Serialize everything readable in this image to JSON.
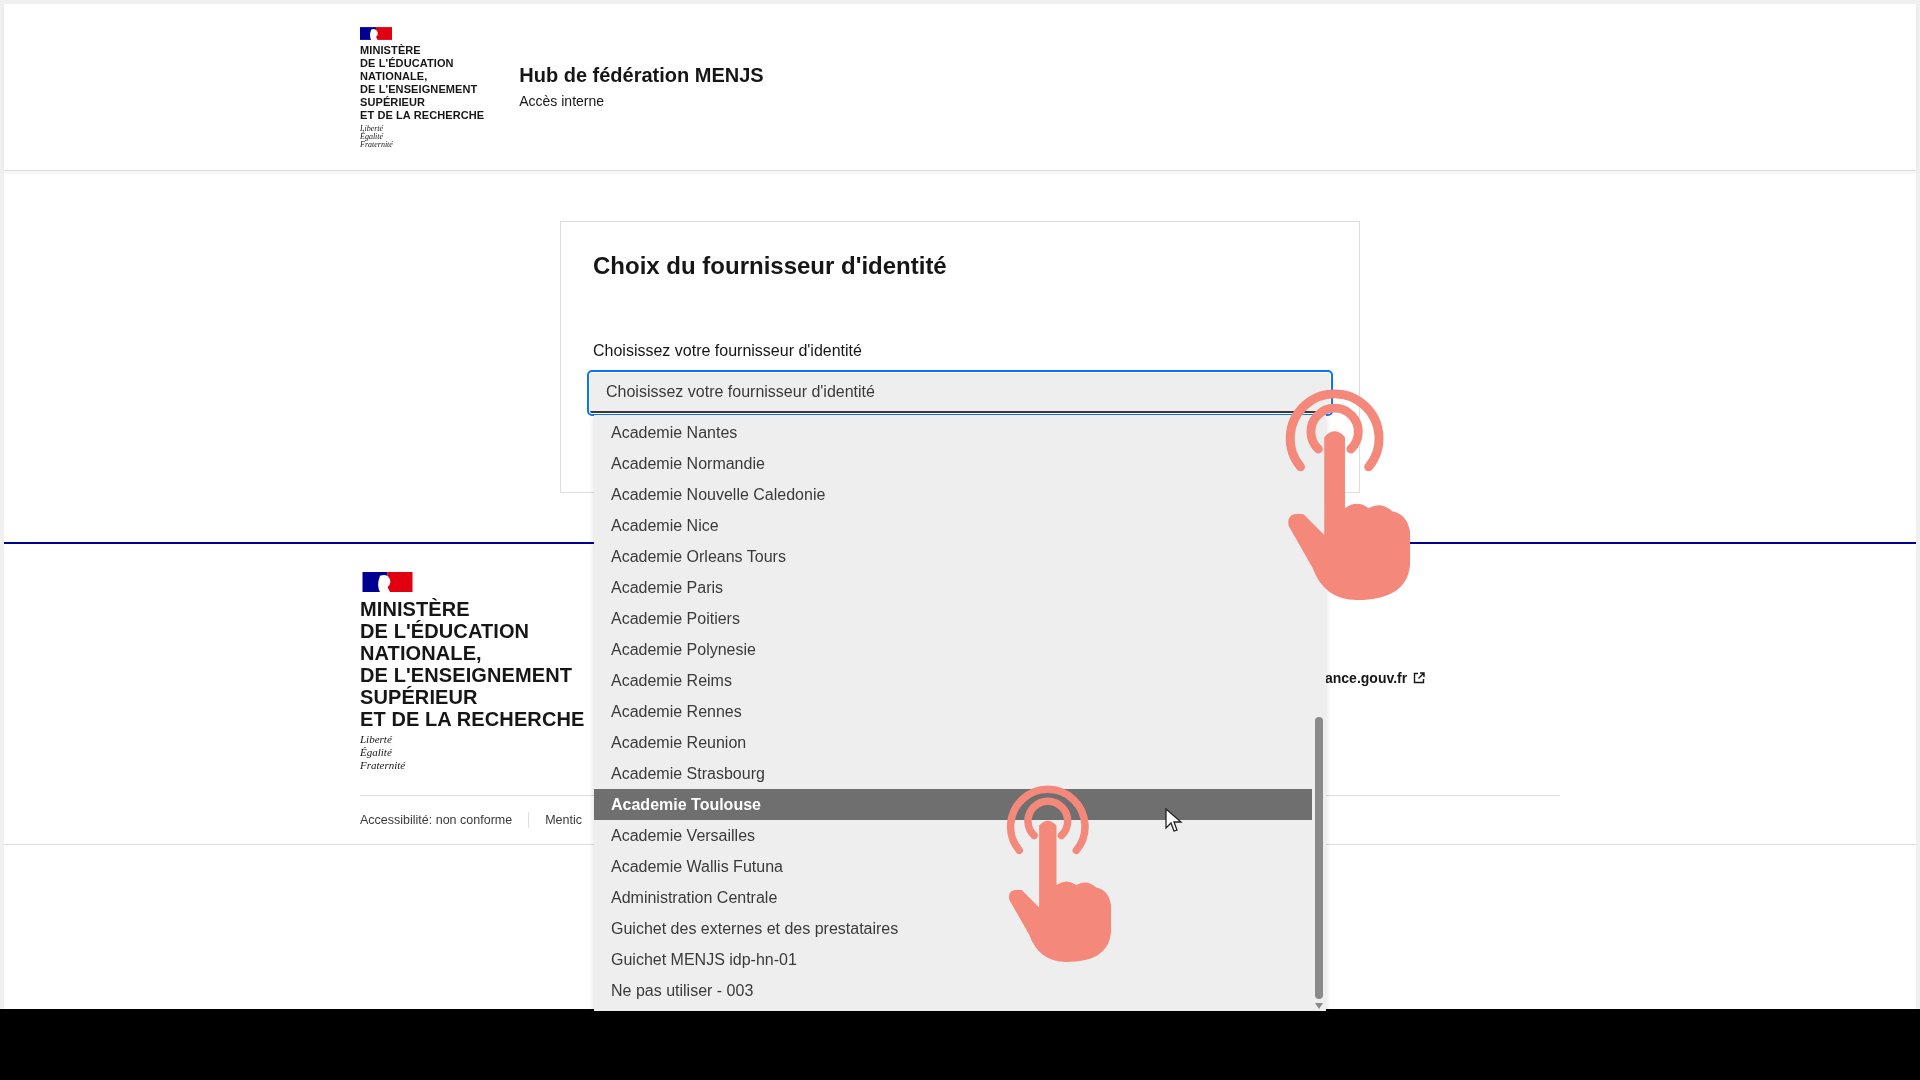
{
  "header": {
    "logo": {
      "lines": [
        "MINISTÈRE",
        "DE L'ÉDUCATION",
        "NATIONALE,",
        "DE L'ENSEIGNEMENT",
        "SUPÉRIEUR",
        "ET DE LA RECHERCHE"
      ],
      "motto": [
        "Liberté",
        "Égalité",
        "Fraternité"
      ]
    },
    "title": "Hub de fédération MENJS",
    "subtitle": "Accès interne"
  },
  "card": {
    "title": "Choix du fournisseur d'identité",
    "label": "Choisissez votre fournisseur d'identité",
    "select": {
      "value": "Choisissez votre fournisseur d'identité",
      "expanded": true
    }
  },
  "dropdown_options": [
    {
      "label": "Academie Nantes",
      "selected": false
    },
    {
      "label": "Academie Normandie",
      "selected": false
    },
    {
      "label": "Academie Nouvelle Caledonie",
      "selected": false
    },
    {
      "label": "Academie Nice",
      "selected": false
    },
    {
      "label": "Academie Orleans Tours",
      "selected": false
    },
    {
      "label": "Academie Paris",
      "selected": false
    },
    {
      "label": "Academie Poitiers",
      "selected": false
    },
    {
      "label": "Academie Polynesie",
      "selected": false
    },
    {
      "label": "Academie Reims",
      "selected": false
    },
    {
      "label": "Academie Rennes",
      "selected": false
    },
    {
      "label": "Academie Reunion",
      "selected": false
    },
    {
      "label": "Academie Strasbourg",
      "selected": false
    },
    {
      "label": "Academie Toulouse",
      "selected": true
    },
    {
      "label": "Academie Versailles",
      "selected": false
    },
    {
      "label": "Academie Wallis Futuna",
      "selected": false
    },
    {
      "label": "Administration Centrale",
      "selected": false
    },
    {
      "label": "Guichet des externes et des prestataires",
      "selected": false
    },
    {
      "label": "Guichet MENJS idp-hn-01",
      "selected": false
    },
    {
      "label": "Ne pas utiliser - 003",
      "selected": false
    }
  ],
  "footer": {
    "logo": {
      "lines": [
        "MINISTÈRE",
        "DE L'ÉDUCATION",
        "NATIONALE,",
        "DE L'ENSEIGNEMENT",
        "SUPÉRIEUR",
        "ET DE LA RECHERCHE"
      ],
      "motto": [
        "Liberté",
        "Égalité",
        "Fraternité"
      ]
    },
    "link": "ance.gouv.fr",
    "bottom_links": [
      "Accessibilité: non conforme",
      "Mentic"
    ]
  }
}
